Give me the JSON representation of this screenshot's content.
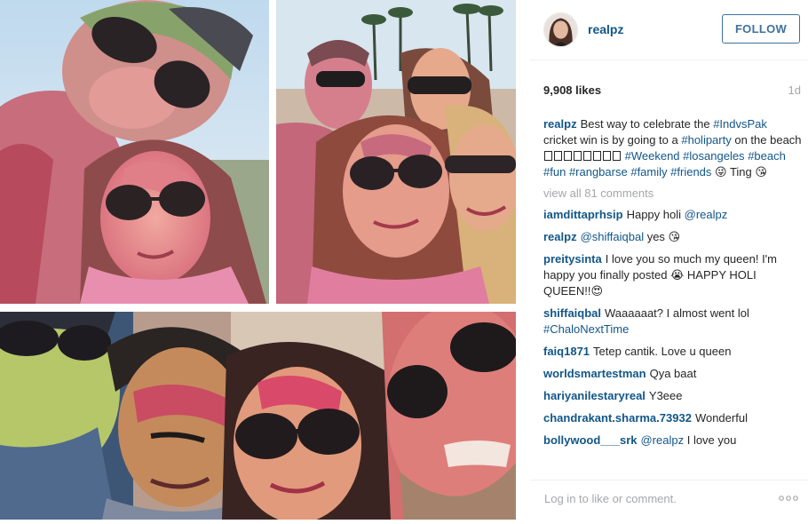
{
  "post": {
    "username": "realpz",
    "follow_label": "FOLLOW",
    "likes": "9,908 likes",
    "age": "1d",
    "caption": {
      "username": "realpz",
      "text_1": "Best way to celebrate the",
      "tag_indvspak": "#IndvsPak",
      "text_2": "cricket win is by going to a",
      "tag_holiparty": "#holiparty",
      "text_3": "on the beach",
      "tag_weekend": "#Weekend",
      "tag_losangeles": "#losangeles",
      "tag_beach": "#beach",
      "tag_fun": "#fun",
      "tag_rangbarse": "#rangbarse",
      "tag_family": "#family",
      "tag_friends": "#friends",
      "text_4": "😜 Ting 😘"
    },
    "view_all_comments": "view all 81 comments",
    "comments": [
      {
        "user": "iamdittaprhsip",
        "text": "Happy holi",
        "mention": "@realpz"
      },
      {
        "user": "realpz",
        "mention": "@shiffaiqbal",
        "text": "yes 😘"
      },
      {
        "user": "preitysinta",
        "text": "I love you so much my queen! I'm happy you finally posted 😭",
        "text_2": "HAPPY HOLI QUEEN!!😍"
      },
      {
        "user": "shiffaiqbal",
        "text": "Waaaaaat? I almost went lol",
        "tag": "#ChaloNextTime"
      },
      {
        "user": "faiq1871",
        "text": "Tetep cantik. Love u queen"
      },
      {
        "user": "worldsmartestman",
        "text": "Qya baat"
      },
      {
        "user": "hariyanilestaryreal",
        "text": "Y3eee"
      },
      {
        "user": "chandrakant.sharma.73932",
        "text": "Wonderful"
      },
      {
        "user": "bollywood___srk",
        "mention": "@realpz",
        "text": "I love you"
      }
    ],
    "login_prompt": "Log in to like or comment."
  },
  "icons": {
    "more": "more-options-icon",
    "avatar": "profile-avatar"
  },
  "colors": {
    "link_blue": "#125688",
    "follow_blue": "#3f729b",
    "muted_grey": "#a5a7aa",
    "text": "#262626"
  }
}
